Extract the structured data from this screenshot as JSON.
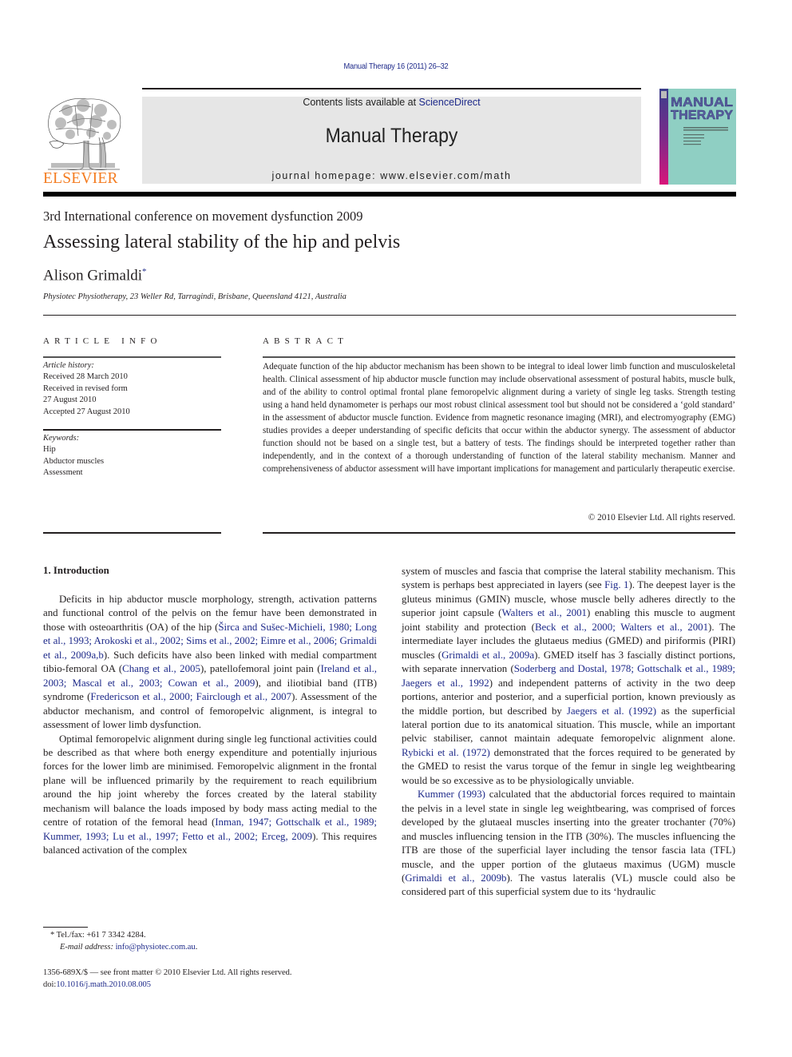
{
  "masthead": {
    "journal_reference": "Manual Therapy 16 (2011) 26–32",
    "contents_prefix": "Contents lists available at ",
    "contents_link": "ScienceDirect",
    "journal_title": "Manual Therapy",
    "homepage": "journal homepage: www.elsevier.com/math",
    "publisher_logo_text": "ELSEVIER",
    "cover": {
      "title_line1": "MANUAL",
      "title_line2": "THERAPY"
    },
    "colors": {
      "link": "#1e2a8a",
      "elsevier_orange": "#f47c20",
      "banner_gray": "#e6e6e6"
    }
  },
  "article": {
    "conference": "3rd International conference on movement dysfunction 2009",
    "title": "Assessing lateral stability of the hip and pelvis",
    "author": "Alison Grimaldi",
    "author_mark": "*",
    "affiliation": "Physiotec Physiotherapy, 23 Weller Rd, Tarragindi, Brisbane, Queensland 4121, Australia"
  },
  "article_info": {
    "label": "ARTICLE INFO",
    "history_label": "Article history:",
    "history": [
      "Received 28 March 2010",
      "Received in revised form",
      "27 August 2010",
      "Accepted 27 August 2010"
    ],
    "keywords_label": "Keywords:",
    "keywords": [
      "Hip",
      "Abductor muscles",
      "Assessment"
    ]
  },
  "abstract": {
    "label": "ABSTRACT",
    "text": "Adequate function of the hip abductor mechanism has been shown to be integral to ideal lower limb function and musculoskeletal health. Clinical assessment of hip abductor muscle function may include observational assessment of postural habits, muscle bulk, and of the ability to control optimal frontal plane femoropelvic alignment during a variety of single leg tasks. Strength testing using a hand held dynamometer is perhaps our most robust clinical assessment tool but should not be considered a ‘gold standard’ in the assessment of abductor muscle function. Evidence from magnetic resonance imaging (MRI), and electromyography (EMG) studies provides a deeper understanding of specific deficits that occur within the abductor synergy. The assessment of abductor function should not be based on a single test, but a battery of tests. The findings should be interpreted together rather than independently, and in the context of a thorough understanding of function of the lateral stability mechanism. Manner and comprehensiveness of abductor assessment will have important implications for management and particularly therapeutic exercise.",
    "copyright": "© 2010 Elsevier Ltd. All rights reserved."
  },
  "body": {
    "section_heading": "1.  Introduction",
    "left_p1": [
      {
        "t": "Deficits in hip abductor muscle morphology, strength, activation patterns and functional control of the pelvis on the femur have been demonstrated in those with osteoarthritis (OA) of the hip ("
      },
      {
        "l": "Širca and Sušec-Michieli, 1980; Long et al., 1993; Arokoski et al., 2002; Sims et al., 2002; Eimre et al., 2006; Grimaldi et al., 2009a,b"
      },
      {
        "t": "). Such deficits have also been linked with medial compartment tibio-femoral OA ("
      },
      {
        "l": "Chang et al., 2005"
      },
      {
        "t": "), patellofemoral joint pain ("
      },
      {
        "l": "Ireland et al., 2003; Mascal et al., 2003; Cowan et al., 2009"
      },
      {
        "t": "), and iliotibial band (ITB) syndrome ("
      },
      {
        "l": "Fredericson et al., 2000; Fairclough et al., 2007"
      },
      {
        "t": "). Assessment of the abductor mechanism, and control of femoropelvic alignment, is integral to assessment of lower limb dysfunction."
      }
    ],
    "left_p2": [
      {
        "t": "Optimal femoropelvic alignment during single leg functional activities could be described as that where both energy expenditure and potentially injurious forces for the lower limb are minimised. Femoropelvic alignment in the frontal plane will be influenced primarily by the requirement to reach equilibrium around the hip joint whereby the forces created by the lateral stability mechanism will balance the loads imposed by body mass acting medial to the centre of rotation of the femoral head ("
      },
      {
        "l": "Inman, 1947; Gottschalk et al., 1989; Kummer, 1993; Lu et al., 1997; Fetto et al., 2002; Erceg, 2009"
      },
      {
        "t": "). This requires balanced activation of the complex"
      }
    ],
    "right_p1": [
      {
        "t": "system of muscles and fascia that comprise the lateral stability mechanism. This system is perhaps best appreciated in layers (see "
      },
      {
        "l": "Fig. 1"
      },
      {
        "t": "). The deepest layer is the gluteus minimus (GMIN) muscle, whose muscle belly adheres directly to the superior joint capsule ("
      },
      {
        "l": "Walters et al., 2001"
      },
      {
        "t": ") enabling this muscle to augment joint stability and protection ("
      },
      {
        "l": "Beck et al., 2000; Walters et al., 2001"
      },
      {
        "t": "). The intermediate layer includes the glutaeus medius (GMED) and piriformis (PIRI) muscles ("
      },
      {
        "l": "Grimaldi et al., 2009a"
      },
      {
        "t": "). GMED itself has 3 fascially distinct portions, with separate innervation ("
      },
      {
        "l": "Soderberg and Dostal, 1978; Gottschalk et al., 1989; Jaegers et al., 1992"
      },
      {
        "t": ") and independent patterns of activity in the two deep portions, anterior and posterior, and a superficial portion, known previously as the middle portion, but described by "
      },
      {
        "l": "Jaegers et al. (1992)"
      },
      {
        "t": " as the superficial lateral portion due to its anatomical situation. This muscle, while an important pelvic stabiliser, cannot maintain adequate femoropelvic alignment alone. "
      },
      {
        "l": "Rybicki et al. (1972)"
      },
      {
        "t": " demonstrated that the forces required to be generated by the GMED to resist the varus torque of the femur in single leg weightbearing would be so excessive as to be physiologically unviable."
      }
    ],
    "right_p2": [
      {
        "l": "Kummer (1993)"
      },
      {
        "t": " calculated that the abductorial forces required to maintain the pelvis in a level state in single leg weightbearing, was comprised of forces developed by the glutaeal muscles inserting into the greater trochanter (70%) and muscles influencing tension in the ITB (30%). The muscles influencing the ITB are those of the superficial layer including the tensor fascia lata (TFL) muscle, and the upper portion of the glutaeus maximus (UGM) muscle ("
      },
      {
        "l": "Grimaldi et al., 2009b"
      },
      {
        "t": "). The vastus lateralis (VL) muscle could also be considered part of this superficial system due to its ‘hydraulic"
      }
    ]
  },
  "footnotes": {
    "tel": "* Tel./fax: +61 7 3342 4284.",
    "email_label": "E-mail address: ",
    "email": "info@physiotec.com.au",
    "email_suffix": ".",
    "issn_line": "1356-689X/$ — see front matter © 2010 Elsevier Ltd. All rights reserved.",
    "doi_label": "doi:",
    "doi": "10.1016/j.math.2010.08.005"
  }
}
